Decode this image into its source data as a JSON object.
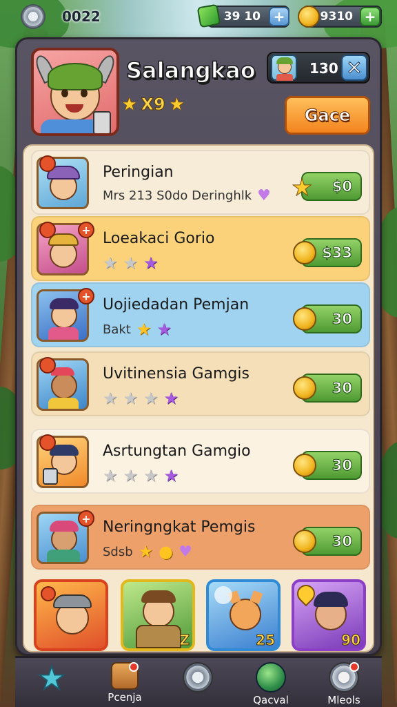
{
  "top": {
    "score": "0022",
    "gems": "39 10",
    "coins": "9310"
  },
  "profile": {
    "name": "Salangkao",
    "rating_text": "X9",
    "friend_count": "130",
    "action_button": "Gace"
  },
  "rows": [
    {
      "name": "Peringian",
      "sub": "Mrs 213 S0do Deringhlk",
      "price": "$0",
      "bg": "#f7ecd7"
    },
    {
      "name": "Loeakaci Gorio",
      "sub": "",
      "price": "$33",
      "bg": "#fbd27a"
    },
    {
      "name": "Uojiedadan Pemjan",
      "sub": "Bakt",
      "price": "30",
      "bg": "#9fd3f0"
    },
    {
      "name": "Uvitinensia Gamgis",
      "sub": "",
      "price": "30",
      "bg": "#f4dfb8"
    },
    {
      "name": "Asrtungtan Gamgio",
      "sub": "",
      "price": "30",
      "bg": "#fbf2e2"
    },
    {
      "name": "Neringngkat Pemgis",
      "sub": "Sdsb",
      "price": "30",
      "bg": "#eea06a"
    }
  ],
  "cards": [
    {
      "num": "",
      "color": "#d9421f"
    },
    {
      "num": "Z",
      "color": "#e2b81c"
    },
    {
      "num": "25",
      "color": "#2f8bd6"
    },
    {
      "num": "90",
      "color": "#8a3fc6"
    }
  ],
  "nav": [
    {
      "label": "",
      "icon": "star-icon"
    },
    {
      "label": "Pcenja",
      "icon": "shop-icon"
    },
    {
      "label": "",
      "icon": "settings-icon"
    },
    {
      "label": "Qacval",
      "icon": "globe-icon"
    },
    {
      "label": "Mleols",
      "icon": "gear-icon"
    }
  ]
}
